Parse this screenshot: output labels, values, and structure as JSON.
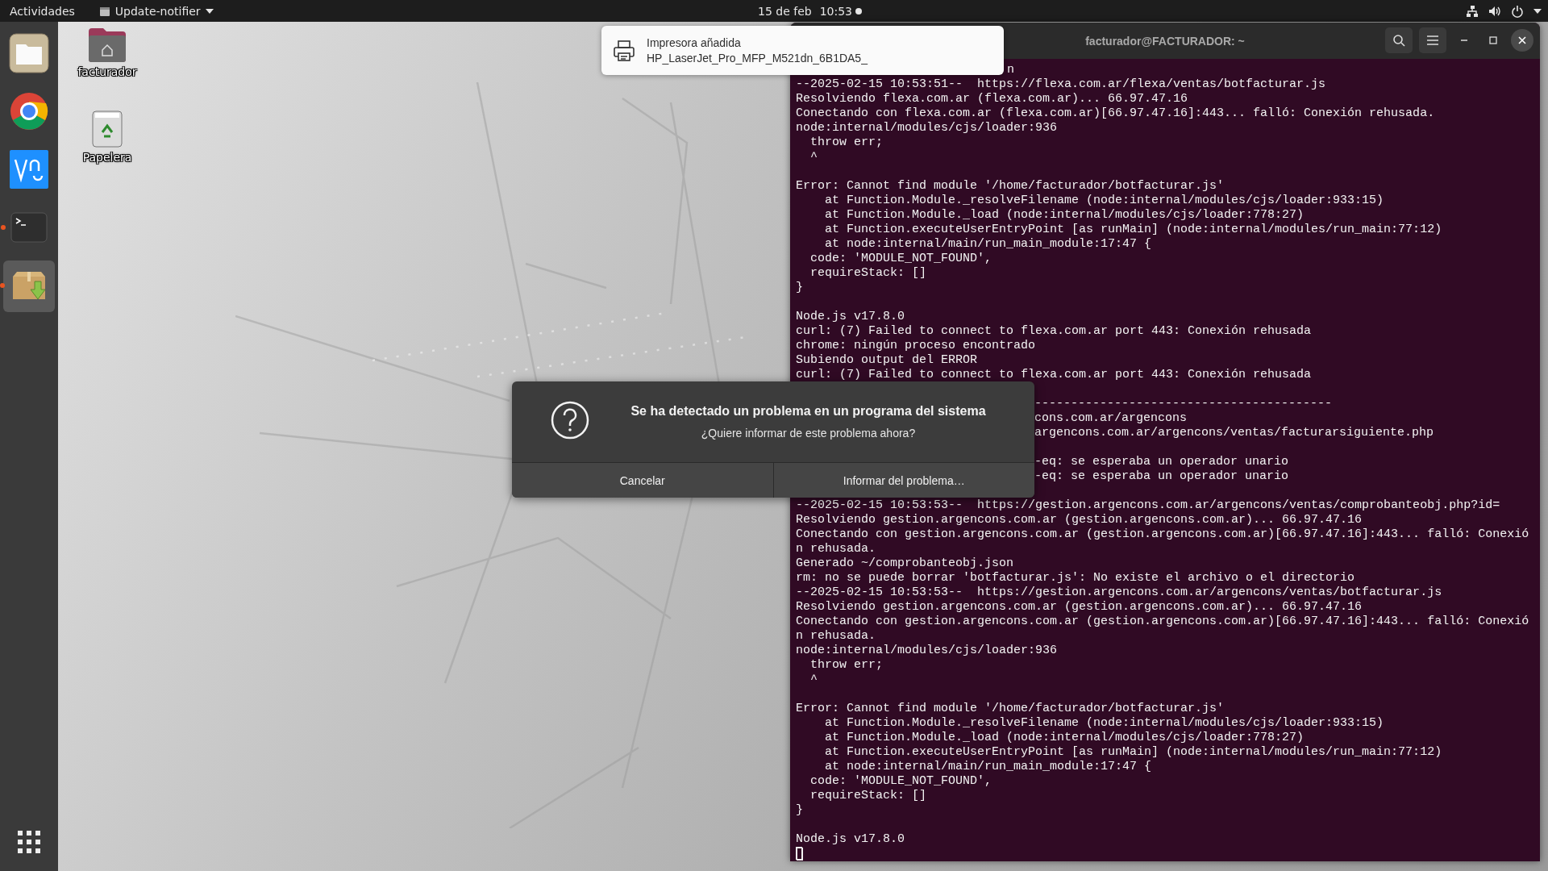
{
  "top_bar": {
    "activities": "Actividades",
    "app_menu": "Update-notifier",
    "date": "15 de feb",
    "time": "10:53"
  },
  "dock": {
    "items": [
      {
        "kind": "files",
        "running": false,
        "selected": false
      },
      {
        "kind": "browser",
        "running": false,
        "selected": false
      },
      {
        "kind": "remote",
        "running": false,
        "selected": false
      },
      {
        "kind": "terminal",
        "running": true,
        "selected": false
      },
      {
        "kind": "installer",
        "running": true,
        "selected": true
      }
    ]
  },
  "desktop_icons": [
    {
      "kind": "home",
      "label": "facturador"
    },
    {
      "kind": "trash",
      "label": "Papelera"
    }
  ],
  "terminal": {
    "title": "facturador@FACTURADOR: ~",
    "lines": [
      {
        "kind": "partial_top",
        "text": "n"
      },
      {
        "kind": "line",
        "text": "--2025-02-15 10:53:51--  https://flexa.com.ar/flexa/ventas/botfacturar.js"
      },
      {
        "kind": "line",
        "text": "Resolviendo flexa.com.ar (flexa.com.ar)... 66.97.47.16"
      },
      {
        "kind": "line",
        "text": "Conectando con flexa.com.ar (flexa.com.ar)[66.97.47.16]:443... falló: Conexión rehusada."
      },
      {
        "kind": "line",
        "text": "node:internal/modules/cjs/loader:936"
      },
      {
        "kind": "line",
        "text": "  throw err;"
      },
      {
        "kind": "line",
        "text": "  ^"
      },
      {
        "kind": "blank"
      },
      {
        "kind": "line",
        "text": "Error: Cannot find module '/home/facturador/botfacturar.js'"
      },
      {
        "kind": "line",
        "text": "    at Function.Module._resolveFilename (node:internal/modules/cjs/loader:933:15)"
      },
      {
        "kind": "line",
        "text": "    at Function.Module._load (node:internal/modules/cjs/loader:778:27)"
      },
      {
        "kind": "line",
        "text": "    at Function.executeUserEntryPoint [as runMain] (node:internal/modules/run_main:77:12)"
      },
      {
        "kind": "line",
        "text": "    at node:internal/main/run_main_module:17:47 {"
      },
      {
        "kind": "line",
        "text": "  code: 'MODULE_NOT_FOUND',"
      },
      {
        "kind": "line",
        "text": "  requireStack: []"
      },
      {
        "kind": "line",
        "text": "}"
      },
      {
        "kind": "blank"
      },
      {
        "kind": "line",
        "text": "Node.js v17.8.0"
      },
      {
        "kind": "line",
        "text": "curl: (7) Failed to connect to flexa.com.ar port 443: Conexión rehusada"
      },
      {
        "kind": "line",
        "text": "chrome: ningún proceso encontrado"
      },
      {
        "kind": "line",
        "text": "Subiendo output del ERROR"
      },
      {
        "kind": "line",
        "text": "curl: (7) Failed to connect to flexa.com.ar port 443: Conexión rehusada"
      },
      {
        "kind": "blank"
      },
      {
        "kind": "partial",
        "text": "-----------------------------------------"
      },
      {
        "kind": "partial",
        "text": "cons.com.ar/argencons"
      },
      {
        "kind": "partial",
        "text": "argencons.com.ar/argencons/ventas/facturarsiguiente.php"
      },
      {
        "kind": "blank"
      },
      {
        "kind": "partial",
        "text": "-eq: se esperaba un operador unario"
      },
      {
        "kind": "partial",
        "text": "-eq: se esperaba un operador unario"
      },
      {
        "kind": "blank"
      },
      {
        "kind": "line",
        "text": "--2025-02-15 10:53:53--  https://gestion.argencons.com.ar/argencons/ventas/comprobanteobj.php?id="
      },
      {
        "kind": "line",
        "text": "Resolviendo gestion.argencons.com.ar (gestion.argencons.com.ar)... 66.97.47.16"
      },
      {
        "kind": "line",
        "text": "Conectando con gestion.argencons.com.ar (gestion.argencons.com.ar)[66.97.47.16]:443... falló: Conexió"
      },
      {
        "kind": "line",
        "text": "n rehusada."
      },
      {
        "kind": "line",
        "text": "Generado ~/comprobanteobj.json"
      },
      {
        "kind": "line",
        "text": "rm: no se puede borrar 'botfacturar.js': No existe el archivo o el directorio"
      },
      {
        "kind": "line",
        "text": "--2025-02-15 10:53:53--  https://gestion.argencons.com.ar/argencons/ventas/botfacturar.js"
      },
      {
        "kind": "line",
        "text": "Resolviendo gestion.argencons.com.ar (gestion.argencons.com.ar)... 66.97.47.16"
      },
      {
        "kind": "line",
        "text": "Conectando con gestion.argencons.com.ar (gestion.argencons.com.ar)[66.97.47.16]:443... falló: Conexió"
      },
      {
        "kind": "line",
        "text": "n rehusada."
      },
      {
        "kind": "line",
        "text": "node:internal/modules/cjs/loader:936"
      },
      {
        "kind": "line",
        "text": "  throw err;"
      },
      {
        "kind": "line",
        "text": "  ^"
      },
      {
        "kind": "blank"
      },
      {
        "kind": "line",
        "text": "Error: Cannot find module '/home/facturador/botfacturar.js'"
      },
      {
        "kind": "line",
        "text": "    at Function.Module._resolveFilename (node:internal/modules/cjs/loader:933:15)"
      },
      {
        "kind": "line",
        "text": "    at Function.Module._load (node:internal/modules/cjs/loader:778:27)"
      },
      {
        "kind": "line",
        "text": "    at Function.executeUserEntryPoint [as runMain] (node:internal/modules/run_main:77:12)"
      },
      {
        "kind": "line",
        "text": "    at node:internal/main/run_main_module:17:47 {"
      },
      {
        "kind": "line",
        "text": "  code: 'MODULE_NOT_FOUND',"
      },
      {
        "kind": "line",
        "text": "  requireStack: []"
      },
      {
        "kind": "line",
        "text": "}"
      },
      {
        "kind": "blank"
      },
      {
        "kind": "line",
        "text": "Node.js v17.8.0"
      },
      {
        "kind": "cursor"
      }
    ]
  },
  "notification": {
    "title": "Impresora añadida",
    "body": "HP_LaserJet_Pro_MFP_M521dn_6B1DA5_"
  },
  "dialog": {
    "title": "Se ha detectado un problema en un programa del sistema",
    "message": "¿Quiere informar de este problema ahora?",
    "buttons": [
      "Cancelar",
      "Informar del problema…"
    ]
  }
}
